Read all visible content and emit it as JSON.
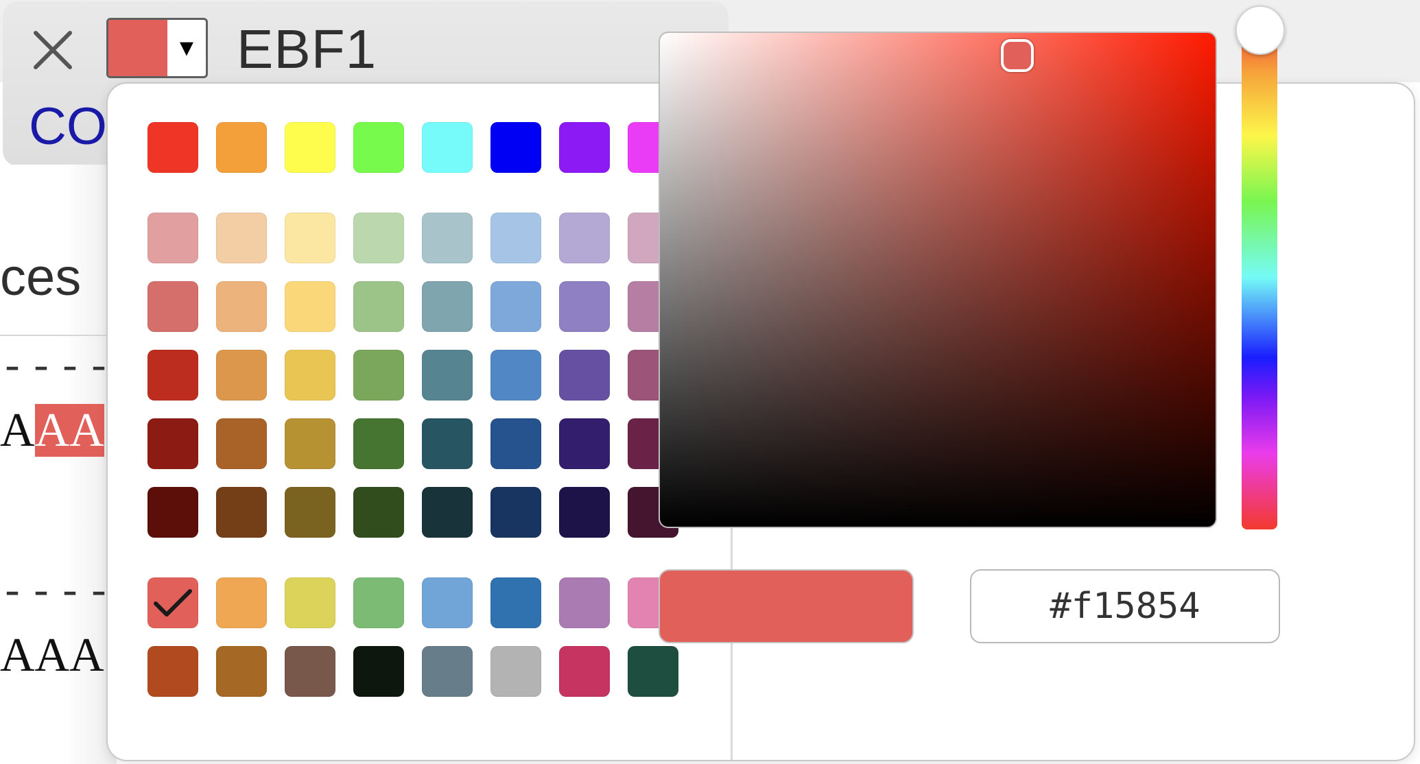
{
  "header": {
    "track_name": "EBF1",
    "link_text": "CO",
    "swatch_color": "#e2605a",
    "dropdown_glyph": "▼"
  },
  "background": {
    "section_text": "ces",
    "dashes_1": "----",
    "dashes_2": "----",
    "seq1_plain": "A",
    "seq1_highlight": "AA",
    "seq2_text": "AAA"
  },
  "picker": {
    "selected_hex": "#f15854",
    "preview_color": "#e2605a",
    "hue_color": "#ff1a00",
    "palette_rows": [
      [
        "#ef3526",
        "#f3a03a",
        "#fefd4d",
        "#78fa4d",
        "#77fbfa",
        "#0000f4",
        "#8b1af5",
        "#ea3bf7"
      ],
      [
        "#e19f9f",
        "#f3cda4",
        "#fbe6a2",
        "#bbd7ae",
        "#a8c4ca",
        "#a6c4e5",
        "#b3a9d4",
        "#d0a7be"
      ],
      [
        "#d46f6b",
        "#ecb47c",
        "#fad87a",
        "#9dc488",
        "#7fa5ae",
        "#7fa8da",
        "#8e80c2",
        "#b67ea2"
      ],
      [
        "#bc2c1f",
        "#dc974d",
        "#e9c554",
        "#7aa75c",
        "#568591",
        "#5287c5",
        "#6550a2",
        "#9c5478"
      ],
      [
        "#8c1b13",
        "#a96228",
        "#b79233",
        "#467431",
        "#275561",
        "#26538e",
        "#331e6e",
        "#6b2247"
      ],
      [
        "#5c0f08",
        "#743e17",
        "#7a6320",
        "#314c1d",
        "#19333b",
        "#183460",
        "#1e1349",
        "#45152f"
      ],
      [
        "#e2605a",
        "#f0a754",
        "#dcd35a",
        "#7bbb73",
        "#71a5d8",
        "#3071b0",
        "#a97bb2",
        "#e283b2"
      ],
      [
        "#b24a20",
        "#a56925",
        "#77584a",
        "#0e170d",
        "#677d8a",
        "#b3b3b3",
        "#c63461",
        "#1e4e3f"
      ]
    ],
    "selected_swatch": [
      6,
      0
    ]
  }
}
